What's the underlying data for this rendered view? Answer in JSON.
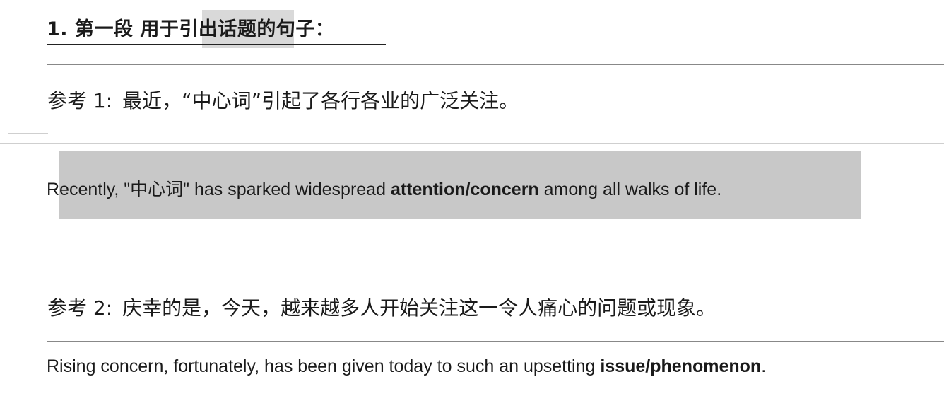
{
  "heading": "1. 第一段  用于引出话题的句子：",
  "ref1": {
    "label": "参考 1:",
    "chinese": "最近，“中心词”引起了各行各业的广泛关注。",
    "english_before": "Recently, \"中心词\" has sparked widespread ",
    "english_bold": "attention/concern",
    "english_after": " among all walks of life."
  },
  "ref2": {
    "label": "参考 2:",
    "chinese": "庆幸的是，今天，越来越多人开始关注这一令人痛心的问题或现象。",
    "english_before": "Rising concern, fortunately, has been given today to such an upsetting ",
    "english_bold": "issue/phenomenon",
    "english_after": "."
  },
  "colors": {
    "highlight": "#c8c8c8",
    "border": "#888888",
    "text": "#1a1a1a"
  }
}
